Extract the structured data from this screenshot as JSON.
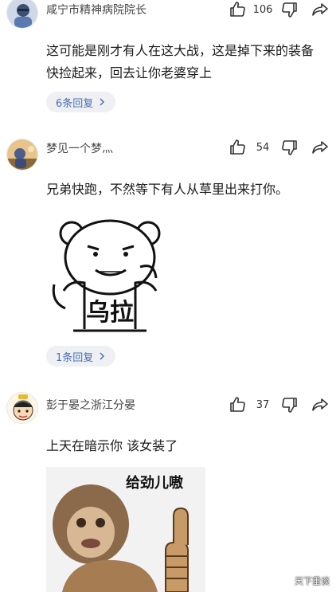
{
  "comments": [
    {
      "username": "咸宁市精神病院院长",
      "likes": "106",
      "text": "这可能是刚才有人在这大战，这是掉下来的装备快捡起来，回去让你老婆穿上",
      "replies_label": "6条回复"
    },
    {
      "username": "梦见一个梦灬",
      "likes": "54",
      "text": "兄弟快跑，不然等下有人从草里出来打你。",
      "sticker_caption": "乌拉",
      "replies_label": "1条回复"
    },
    {
      "username": "彭于晏之浙江分晏",
      "likes": "37",
      "text": "上天在暗示你 该女装了",
      "sticker_caption": "给劲儿嗷"
    }
  ],
  "icons": {
    "like": "thumbs-up-icon",
    "dislike": "thumbs-down-icon",
    "share": "share-arrow-icon",
    "reply_chevron": "chevron-right-icon"
  },
  "colors": {
    "reply_link": "#4a6fb0",
    "reply_bg": "#eef0f4"
  },
  "watermark": "天下重谈"
}
